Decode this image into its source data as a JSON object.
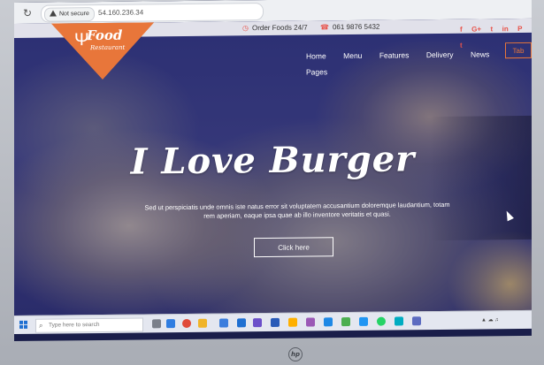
{
  "browser": {
    "security_label": "Not secure",
    "url": "54.160.236.34"
  },
  "topbar": {
    "order_text": "Order Foods 24/7",
    "phone_text": "061 9876 5432",
    "social": [
      "f",
      "G+",
      "t",
      "in",
      "P",
      "t"
    ]
  },
  "logo": {
    "title": "Food",
    "subtitle": "Restaurant"
  },
  "nav": {
    "items": [
      "Home",
      "Menu",
      "Features",
      "Delivery",
      "News",
      "Pages"
    ],
    "extra_button": "Tab"
  },
  "hero": {
    "headline": "I Love Burger",
    "subtitle_line1": "Sed ut perspiciatis unde omnis iste natus error sit voluptatem accusantium doloremque laudantium, totam",
    "subtitle_line2": "rem aperiam, eaque ipsa quae ab illo inventore veritatis et quasi.",
    "cta_label": "Click here"
  },
  "taskbar": {
    "search_placeholder": "Type here to search"
  },
  "device": {
    "brand": "hp"
  },
  "colors": {
    "accent": "#e8763a",
    "social": "#e8534a"
  }
}
